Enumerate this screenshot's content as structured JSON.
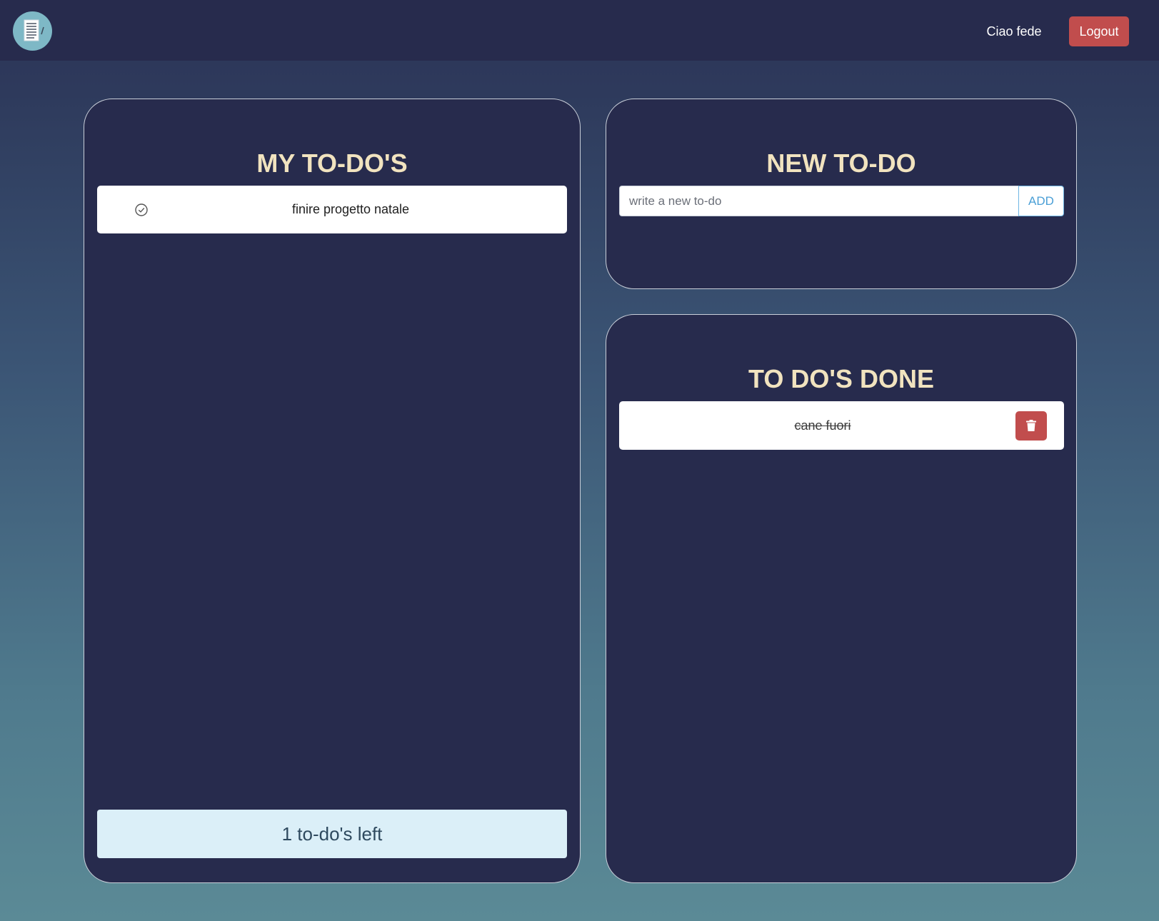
{
  "navbar": {
    "logo_icon": "notepad-icon",
    "greeting": "Ciao fede",
    "logout_label": "Logout"
  },
  "todos_panel": {
    "title": "MY TO-DO'S",
    "items": [
      {
        "text": "finire progetto natale",
        "icon": "check-circle-icon"
      }
    ],
    "counter": "1 to-do's left"
  },
  "new_panel": {
    "title": "NEW TO-DO",
    "input_placeholder": "write a new to-do",
    "input_value": "",
    "add_label": "ADD"
  },
  "done_panel": {
    "title": "TO DO'S DONE",
    "items": [
      {
        "text": "cane fuori",
        "icon": "trash-icon"
      }
    ]
  },
  "colors": {
    "navbar_bg": "#272b4d",
    "panel_bg": "#272b4d",
    "title_color": "#f1e3bf",
    "danger": "#c14d4d",
    "accent": "#4a9fd6",
    "counter_bg": "#dbeff8"
  }
}
